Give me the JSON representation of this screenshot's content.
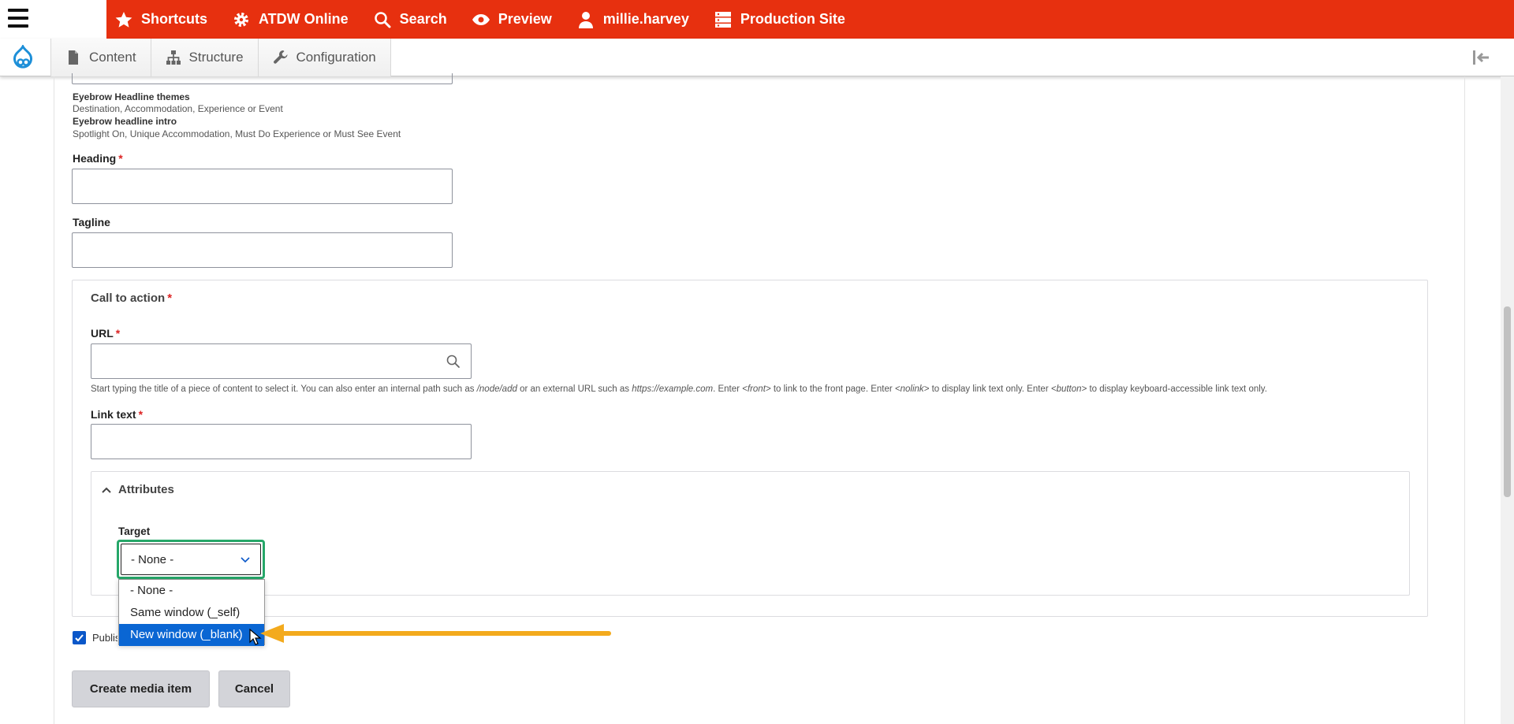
{
  "toolbar": {
    "items": [
      {
        "label": "Shortcuts",
        "icon": "star-icon"
      },
      {
        "label": "ATDW Online",
        "icon": "gear-icon"
      },
      {
        "label": "Search",
        "icon": "search-icon"
      },
      {
        "label": "Preview",
        "icon": "eye-icon"
      },
      {
        "label": "millie.harvey",
        "icon": "user-icon"
      },
      {
        "label": "Production Site",
        "icon": "server-icon"
      }
    ],
    "accent": "#e7300f"
  },
  "tray": {
    "items": [
      {
        "label": "Content",
        "icon": "document-icon"
      },
      {
        "label": "Structure",
        "icon": "sitemap-icon"
      },
      {
        "label": "Configuration",
        "icon": "wrench-icon"
      }
    ]
  },
  "form": {
    "eyebrow_themes_title": "Eyebrow Headline themes",
    "eyebrow_themes_text": "Destination, Accommodation, Experience or Event",
    "eyebrow_intro_title": "Eyebrow headline intro",
    "eyebrow_intro_text": "Spotlight On, Unique Accommodation, Must Do Experience or Must See Event",
    "heading_label": "Heading",
    "tagline_label": "Tagline",
    "required_mark": "*",
    "cta": {
      "title": "Call to action",
      "url_label": "URL",
      "url_desc_1": "Start typing the title of a piece of content to select it. You can also enter an internal path such as ",
      "url_desc_node": "/node/add",
      "url_desc_2": " or an external URL such as ",
      "url_desc_example": "https://example.com",
      "url_desc_3": ". Enter ",
      "url_desc_front": "<front>",
      "url_desc_4": " to link to the front page. Enter ",
      "url_desc_nolink": "<nolink>",
      "url_desc_5": " to display link text only. Enter ",
      "url_desc_button": "<button>",
      "url_desc_6": " to display keyboard-accessible link text only.",
      "link_text_label": "Link text",
      "attributes": {
        "title": "Attributes",
        "target_label": "Target",
        "target_selected": "- None -",
        "options": [
          "- None -",
          "Same window (_self)",
          "New window (_blank)"
        ]
      }
    },
    "published_label": "Published",
    "create_button": "Create media item",
    "cancel_button": "Cancel"
  }
}
